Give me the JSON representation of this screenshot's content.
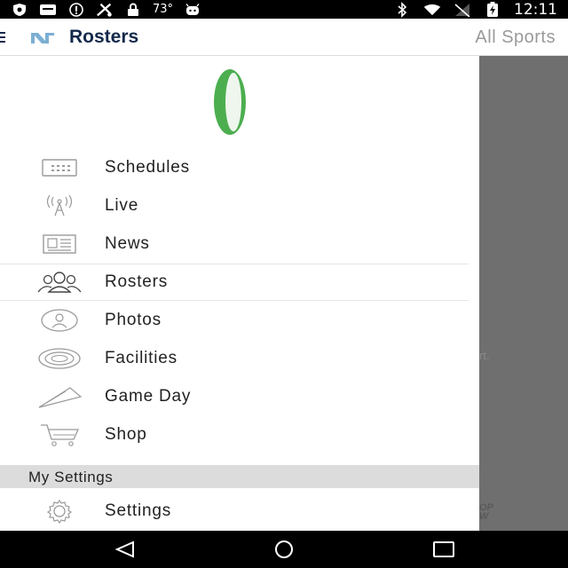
{
  "status_bar": {
    "temperature": "73°",
    "time": "12:11",
    "icons_left": [
      "shield-icon",
      "message-icon",
      "alert-icon",
      "sports-icon",
      "lock-icon",
      "temperature",
      "android-icon"
    ],
    "icons_right": [
      "bluetooth-icon",
      "wifi-icon",
      "no-signal-icon",
      "battery-icon"
    ]
  },
  "app_bar": {
    "title": "Rosters",
    "right_title": "All Sports",
    "logo": "nc-logo",
    "brand_color": "#13294b"
  },
  "drawer": {
    "header_logo": "green-ring-logo",
    "items": [
      {
        "label": "Schedules",
        "icon": "calendar-icon"
      },
      {
        "label": "Live",
        "icon": "antenna-icon"
      },
      {
        "label": "News",
        "icon": "newspaper-icon"
      },
      {
        "label": "Rosters",
        "icon": "people-icon",
        "active": true
      },
      {
        "label": "Photos",
        "icon": "photo-person-icon"
      },
      {
        "label": "Facilities",
        "icon": "stadium-icon"
      },
      {
        "label": "Game Day",
        "icon": "pennant-icon"
      },
      {
        "label": "Shop",
        "icon": "cart-icon"
      }
    ],
    "section_header": "My Settings",
    "settings_item": {
      "label": "Settings",
      "icon": "gear-icon"
    }
  },
  "background_peek": {
    "text1": "rt.",
    "text2": "OP\nW"
  },
  "colors": {
    "accent_green": "#4cae4f",
    "overlay": "#6f6f6f",
    "section_bg": "#dcdcdc"
  }
}
